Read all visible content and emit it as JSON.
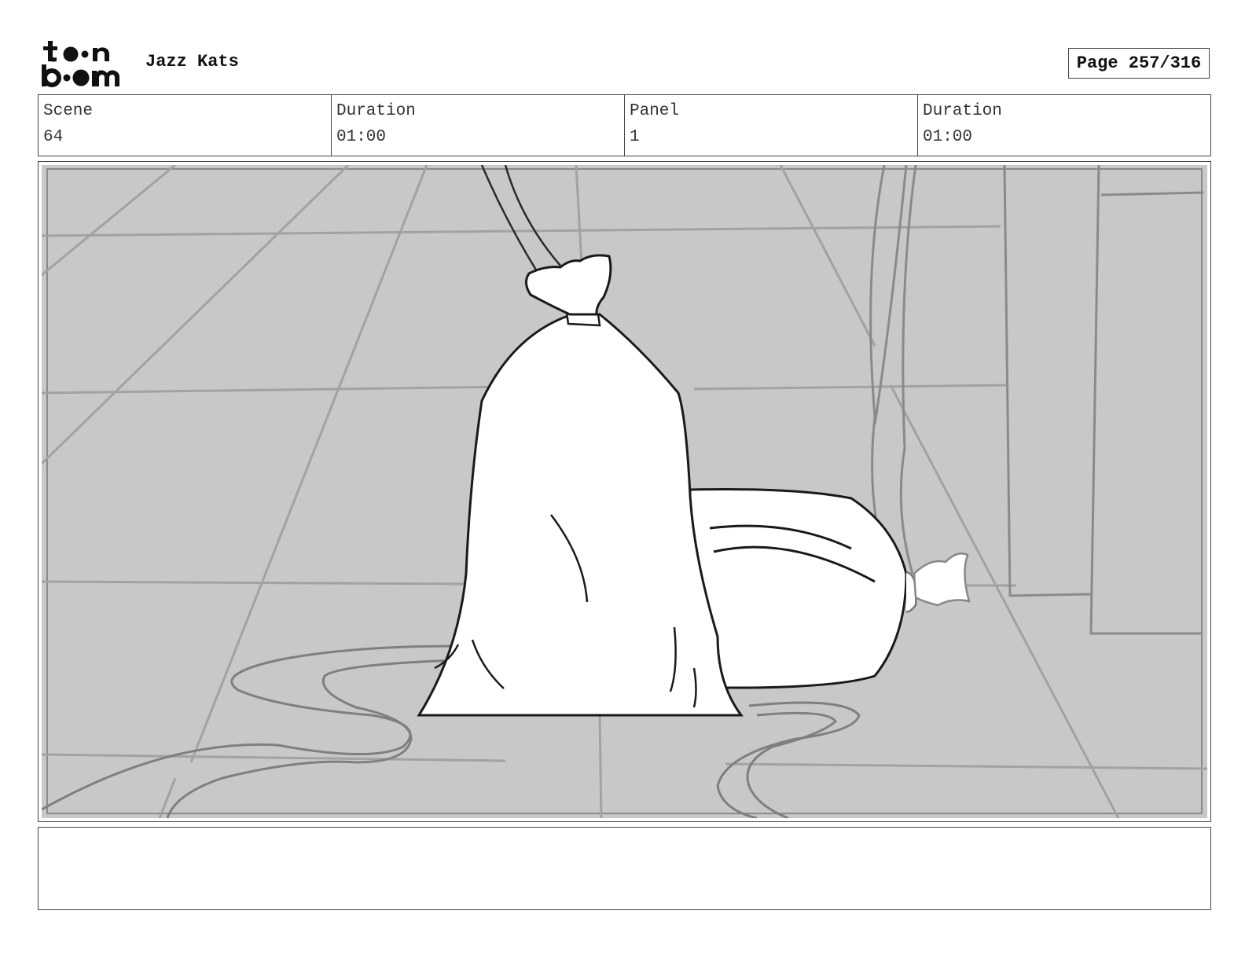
{
  "header": {
    "logo_text_line1": "toon",
    "logo_text_line2": "boom",
    "project_title": "Jazz Kats",
    "page_label": "Page 257/316"
  },
  "info": {
    "scene_label": "Scene",
    "scene_value": "64",
    "scene_duration_label": "Duration",
    "scene_duration_value": "01:00",
    "panel_label": "Panel",
    "panel_value": "1",
    "panel_duration_label": "Duration",
    "panel_duration_value": "01:00"
  },
  "notes": {
    "text": ""
  }
}
